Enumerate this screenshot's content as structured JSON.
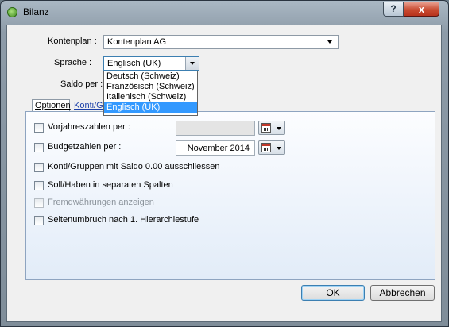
{
  "window": {
    "title": "Bilanz"
  },
  "titlebar": {
    "help_label": "?",
    "close_label": "x"
  },
  "form": {
    "kontenplan_label": "Kontenplan :",
    "kontenplan_value": "Kontenplan AG",
    "sprache_label": "Sprache :",
    "sprache_value": "Englisch (UK)",
    "saldo_label": "Saldo per :"
  },
  "language_dropdown": {
    "options": [
      "Deutsch (Schweiz)",
      "Französisch (Schweiz)",
      "Italienisch (Schweiz)",
      "Englisch (UK)"
    ],
    "selected": "Englisch (UK)"
  },
  "tabs": [
    {
      "label": "Optionen"
    },
    {
      "label": "Konti/Gr"
    }
  ],
  "options": {
    "vorjahr_label": "Vorjahreszahlen per :",
    "vorjahr_value": "",
    "budget_label": "Budgetzahlen per :",
    "budget_value": "November 2014",
    "konti_label": "Konti/Gruppen mit Saldo 0.00 ausschliessen",
    "sollhaben_label": "Soll/Haben in separaten Spalten",
    "fremd_label": "Fremdwährungen anzeigen",
    "seiten_label": "Seitenumbruch nach 1. Hierarchiestufe"
  },
  "buttons": {
    "ok": "OK",
    "cancel": "Abbrechen"
  },
  "colors": {
    "accent": "#3399ff",
    "link": "#1b3fa8",
    "close": "#c84a30"
  }
}
